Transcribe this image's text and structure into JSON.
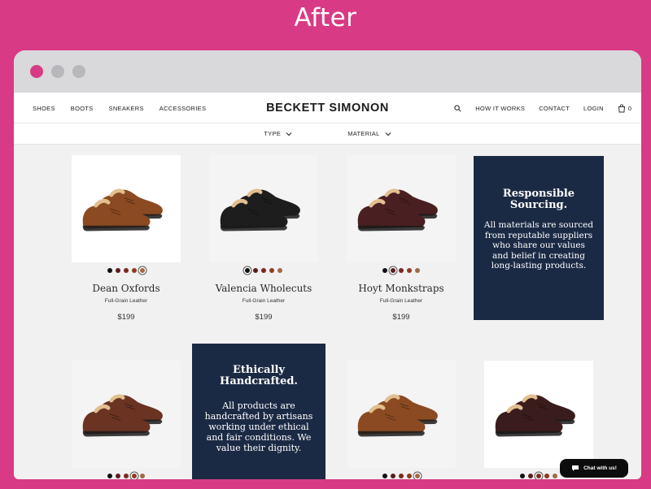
{
  "headline": "After",
  "nav": {
    "left": [
      "SHOES",
      "BOOTS",
      "SNEAKERS",
      "ACCESSORIES"
    ],
    "brand": "BECKETT SIMONON",
    "right": [
      "HOW IT WORKS",
      "CONTACT",
      "LOGIN"
    ],
    "cart_count": "0"
  },
  "filters": [
    "TYPE",
    "MATERIAL"
  ],
  "products": [
    {
      "name": "Dean Oxfords",
      "material": "Full-Grain Leather",
      "price": "$199",
      "color": "#8c4a22"
    },
    {
      "name": "Valencia Wholecuts",
      "material": "Full-Grain Leather",
      "price": "$199",
      "color": "#1d1d1d"
    },
    {
      "name": "Hoyt Monkstraps",
      "material": "Full-Grain Leather",
      "price": "$199",
      "color": "#4a1f22"
    }
  ],
  "promos": {
    "sourcing": {
      "title": "Responsible Sourcing.",
      "body": "All materials are sourced from reputable suppliers who share our values and belief in creating long-lasting products."
    },
    "handcrafted": {
      "title": "Ethically Handcrafted.",
      "body": "All products are handcrafted by artisans working under ethical and fair conditions. We value their dignity."
    }
  },
  "chat_label": "Chat with us!",
  "swatch_colors": [
    "#111111",
    "#5a1d1d",
    "#7a2a1c",
    "#8e3b22",
    "#a06a44"
  ]
}
